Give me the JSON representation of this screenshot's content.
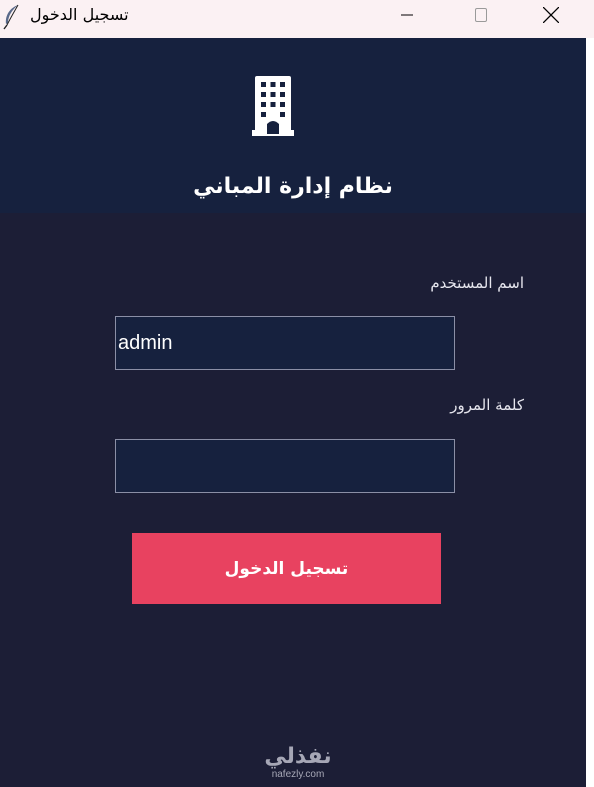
{
  "window": {
    "title": "تسجيل الدخول",
    "icons": {
      "app": "feather-icon",
      "minimize": "minimize-icon",
      "maximize": "maximize-icon",
      "close": "close-icon"
    }
  },
  "header": {
    "icon": "building-icon",
    "title": "نظام إدارة المباني",
    "background": "#16213e"
  },
  "form": {
    "username_label": "اسم المستخدم",
    "username_value": "admin",
    "password_label": "كلمة المرور",
    "password_value": "",
    "submit_label": "تسجيل الدخول",
    "submit_color": "#e84260"
  },
  "watermark": {
    "text": "نفذلي",
    "url": "nafezly.com"
  }
}
